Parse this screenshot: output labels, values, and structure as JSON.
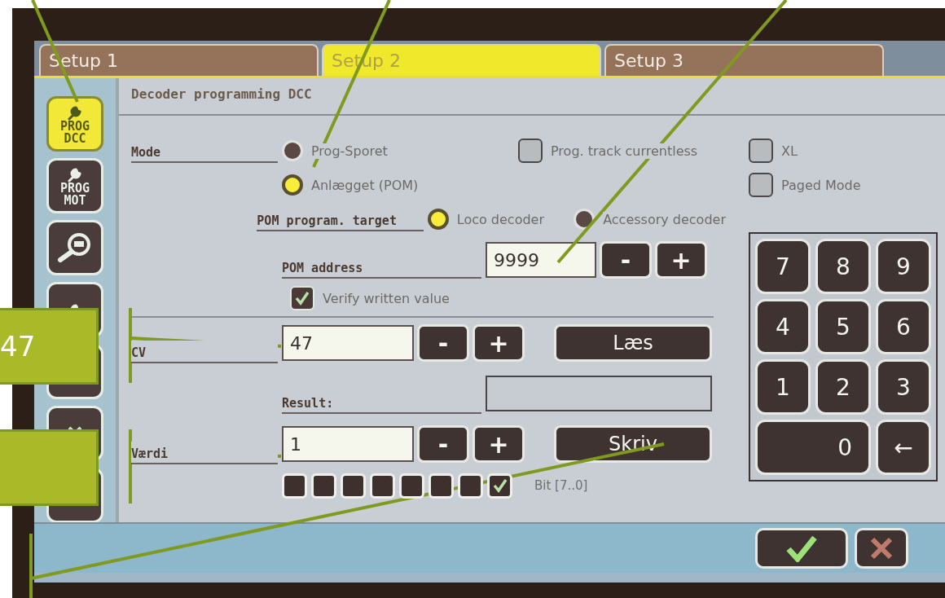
{
  "tabs": [
    {
      "label": "Setup 1",
      "selected": false
    },
    {
      "label": "Setup 2",
      "selected": true
    },
    {
      "label": "Setup 3",
      "selected": false
    }
  ],
  "sidebar": {
    "items": [
      {
        "lines": [
          "PROG",
          "DCC"
        ],
        "selected": true
      },
      {
        "lines": [
          "PROG",
          "MOT"
        ],
        "selected": false
      },
      {
        "selected": false
      },
      {
        "selected": false
      },
      {
        "selected": false
      },
      {
        "selected": false
      },
      {
        "selected": false
      }
    ]
  },
  "panel_title": "Decoder programming DCC",
  "mode": {
    "label": "Mode",
    "options": [
      {
        "label": "Prog-Sporet",
        "selected": false
      },
      {
        "label": "Anlægget (POM)",
        "selected": true
      }
    ]
  },
  "options": [
    {
      "label": "Prog. track currentless",
      "checked": false
    },
    {
      "label": "XL",
      "checked": false
    },
    {
      "label": "Paged Mode",
      "checked": false
    }
  ],
  "pom_target": {
    "label": "POM program. target",
    "options": [
      {
        "label": "Loco decoder",
        "selected": true
      },
      {
        "label": "Accessory decoder",
        "selected": false
      }
    ]
  },
  "pom_address": {
    "label": "POM address",
    "value": "9999",
    "minus": "-",
    "plus": "+"
  },
  "verify": {
    "label": "Verify written value",
    "checked": true
  },
  "cv": {
    "label": "CV",
    "value": "47",
    "minus": "-",
    "plus": "+",
    "button": "Læs"
  },
  "result": {
    "label": "Result:"
  },
  "value": {
    "label": "Værdi",
    "value": "1",
    "minus": "-",
    "plus": "+",
    "button": "Skriv"
  },
  "bits": {
    "label": "Bit [7..0]",
    "items": [
      {
        "checked": false
      },
      {
        "checked": false
      },
      {
        "checked": false
      },
      {
        "checked": false
      },
      {
        "checked": false
      },
      {
        "checked": false
      },
      {
        "checked": false
      },
      {
        "checked": true
      }
    ]
  },
  "keypad": {
    "keys": [
      {
        "label": "7",
        "wide": false
      },
      {
        "label": "8",
        "wide": false
      },
      {
        "label": "9",
        "wide": false
      },
      {
        "label": "4",
        "wide": false
      },
      {
        "label": "5",
        "wide": false
      },
      {
        "label": "6",
        "wide": false
      },
      {
        "label": "1",
        "wide": false
      },
      {
        "label": "2",
        "wide": false
      },
      {
        "label": "3",
        "wide": false
      },
      {
        "label": "0",
        "wide": true
      },
      {
        "label": "←",
        "wide": false
      }
    ]
  },
  "footer": {
    "buttons": [
      {
        "kind": "ok"
      },
      {
        "kind": "cancel"
      }
    ]
  },
  "annotations": {
    "callouts": [
      {
        "kind": "text",
        "text": "47"
      },
      {
        "kind": "blank"
      }
    ]
  }
}
